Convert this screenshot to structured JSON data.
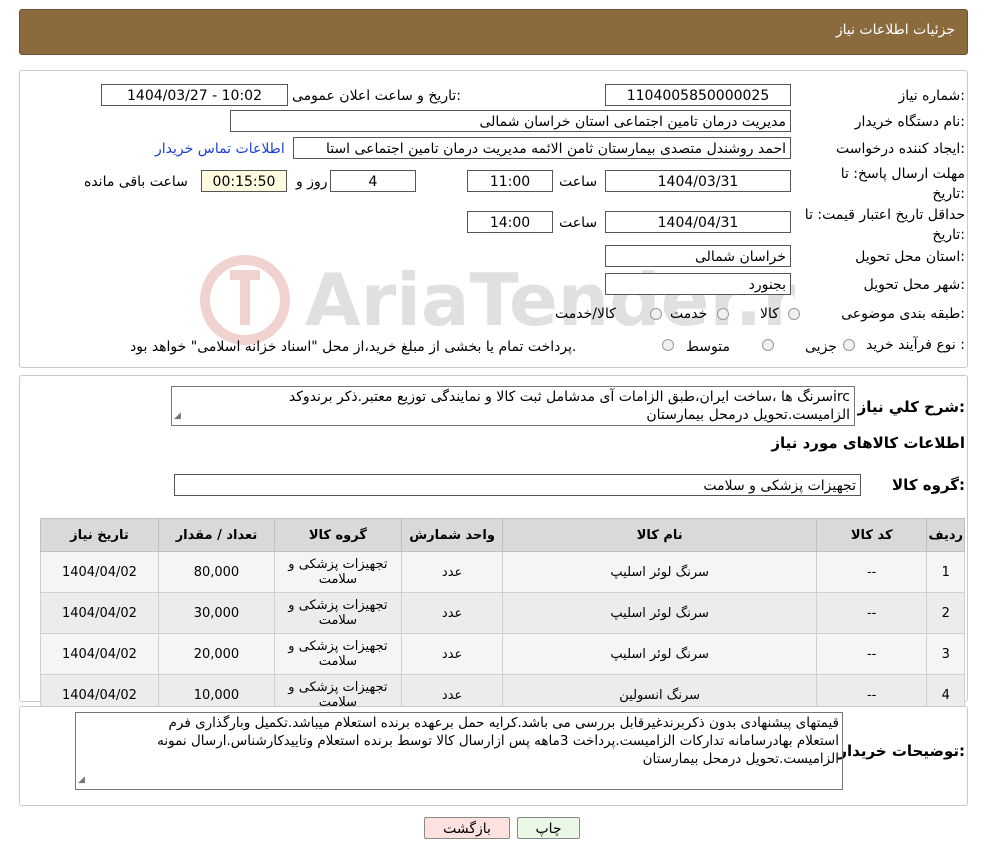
{
  "header": {
    "title": "جزئیات اطلاعات نیاز"
  },
  "form": {
    "need_number_label": "شماره نیاز:",
    "need_number": "1104005850000025",
    "announce_label": "تاریخ و ساعت اعلان عمومی:",
    "announce_value": "1404/03/27 - 10:02",
    "buyer_org_label": "نام دستگاه خریدار:",
    "buyer_org": "مدیریت درمان تامین اجتماعی استان خراسان شمالی",
    "requester_label": "ایجاد کننده درخواست:",
    "requester": "احمد روشندل متصدی بیمارستان ثامن الائمه مدیریت درمان تامین اجتماعی استا",
    "contact_link": "اطلاعات تماس خریدار",
    "deadline_label": "مهلت ارسال پاسخ: تا تاریخ:",
    "deadline_date": "1404/03/31",
    "time_label": "ساعت",
    "deadline_time": "11:00",
    "days_value": "4",
    "days_label": "روز و",
    "remaining_time": "00:15:50",
    "remaining_label": "ساعت باقی مانده",
    "validity_label": "حداقل تاریخ اعتبار قیمت: تا تاریخ:",
    "validity_date": "1404/04/31",
    "validity_time": "14:00",
    "province_label": "استان محل تحویل:",
    "province": "خراسان شمالی",
    "city_label": "شهر محل تحویل:",
    "city": "بجنورد",
    "category_label": "طبقه بندی موضوعی:",
    "category_options": [
      "کالا",
      "خدمت",
      "کالا/خدمت"
    ],
    "process_label": "نوع فرآیند خرید :",
    "process_options": [
      "جزیی",
      "متوسط"
    ],
    "process_note": "پرداخت تمام یا بخشی از مبلغ خرید،از محل \"اسناد خزانه اسلامی\" خواهد بود."
  },
  "summary": {
    "label": "شرح کلي نياز:",
    "text_line1": "سرنگ ها ،ساخت ایران،طبق الزامات آی مدشامل ثبت کالا و نمایندگی توزیع معتبر.ذکر برندوکدirc",
    "text_line2": "الزامیست.تحویل درمحل بیمارستان",
    "goods_info_title": "اطلاعات کالاهای مورد نیاز",
    "goods_group_label": "گروه کالا:",
    "goods_group": "تجهیزات پزشکی و سلامت"
  },
  "table": {
    "headers": [
      "ردیف",
      "کد کالا",
      "نام کالا",
      "واحد شمارش",
      "گروه کالا",
      "تعداد / مقدار",
      "تاریخ نیاز"
    ],
    "rows": [
      [
        "1",
        "--",
        "سرنگ لوئر اسلیپ",
        "عدد",
        "تجهیزات پزشکی و سلامت",
        "80,000",
        "1404/04/02"
      ],
      [
        "2",
        "--",
        "سرنگ لوئر اسلیپ",
        "عدد",
        "تجهیزات پزشکی و سلامت",
        "30,000",
        "1404/04/02"
      ],
      [
        "3",
        "--",
        "سرنگ لوئر اسلیپ",
        "عدد",
        "تجهیزات پزشکی و سلامت",
        "20,000",
        "1404/04/02"
      ],
      [
        "4",
        "--",
        "سرنگ انسولین",
        "عدد",
        "تجهیزات پزشکی و سلامت",
        "10,000",
        "1404/04/02"
      ]
    ]
  },
  "buyer_notes": {
    "label": "توضیحات خریدار:",
    "line1": "قیمتهای پیشنهادی بدون ذکربرندغیرقابل بررسی می باشد.کرایه حمل برعهده برنده استعلام میباشد.تکمیل وبارگذاری فرم",
    "line2": "استعلام بهادرسامانه تدارکات الزامیست.پرداخت 3ماهه پس ازارسال کالا توسط برنده استعلام وتاییدکارشناس.ارسال نمونه",
    "line3": "الزامیست.تحویل درمحل بیمارستان"
  },
  "buttons": {
    "print": "چاپ",
    "back": "بازگشت"
  },
  "watermark": {
    "text": "AriaTender.neT"
  },
  "colors": {
    "header_bg": "#8b6b3d",
    "link": "#1a3fd6",
    "back_button_bg": "#fde0e0",
    "print_button_bg": "#eaf7e4"
  }
}
